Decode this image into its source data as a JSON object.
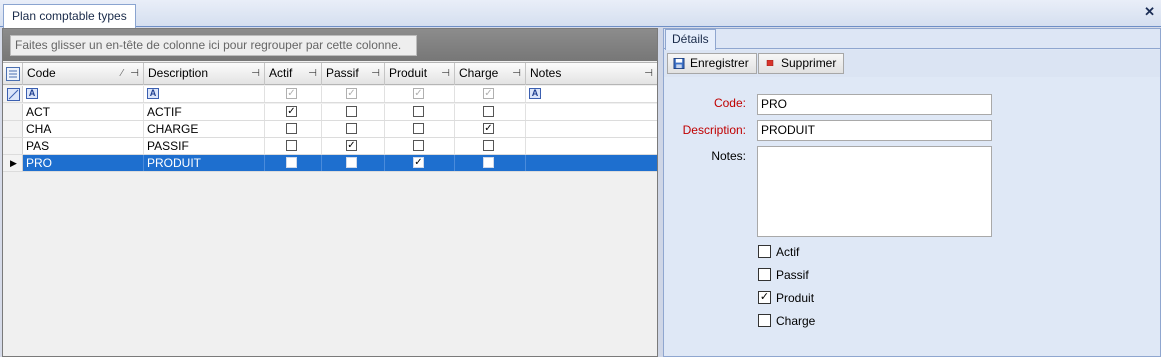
{
  "window": {
    "tab_title": "Plan comptable types",
    "close_glyph": "✕"
  },
  "grid": {
    "group_hint": "Faites glisser un en-tête de colonne ici pour regrouper par cette colonne.",
    "columns": [
      "Code",
      "Description",
      "Actif",
      "Passif",
      "Produit",
      "Charge",
      "Notes"
    ],
    "filter_text_glyph": "A",
    "rows": [
      {
        "code": "ACT",
        "description": "ACTIF",
        "actif": true,
        "passif": false,
        "produit": false,
        "charge": false,
        "notes": ""
      },
      {
        "code": "CHA",
        "description": "CHARGE",
        "actif": false,
        "passif": false,
        "produit": false,
        "charge": true,
        "notes": ""
      },
      {
        "code": "PAS",
        "description": "PASSIF",
        "actif": false,
        "passif": true,
        "produit": false,
        "charge": false,
        "notes": ""
      },
      {
        "code": "PRO",
        "description": "PRODUIT",
        "actif": false,
        "passif": false,
        "produit": true,
        "charge": false,
        "notes": ""
      }
    ],
    "selected_row_index": 3
  },
  "details": {
    "tab_label": "Détails",
    "save_label": "Enregistrer",
    "delete_label": "Supprimer",
    "code_label": "Code:",
    "code_value": "PRO",
    "description_label": "Description:",
    "description_value": "PRODUIT",
    "notes_label": "Notes:",
    "notes_value": "",
    "checkboxes": [
      {
        "label": "Actif",
        "checked": false
      },
      {
        "label": "Passif",
        "checked": false
      },
      {
        "label": "Produit",
        "checked": true
      },
      {
        "label": "Charge",
        "checked": false
      }
    ]
  },
  "colors": {
    "selection": "#1e6fcf",
    "required_label": "#c00000",
    "panel_bg": "#dfe8f6"
  }
}
